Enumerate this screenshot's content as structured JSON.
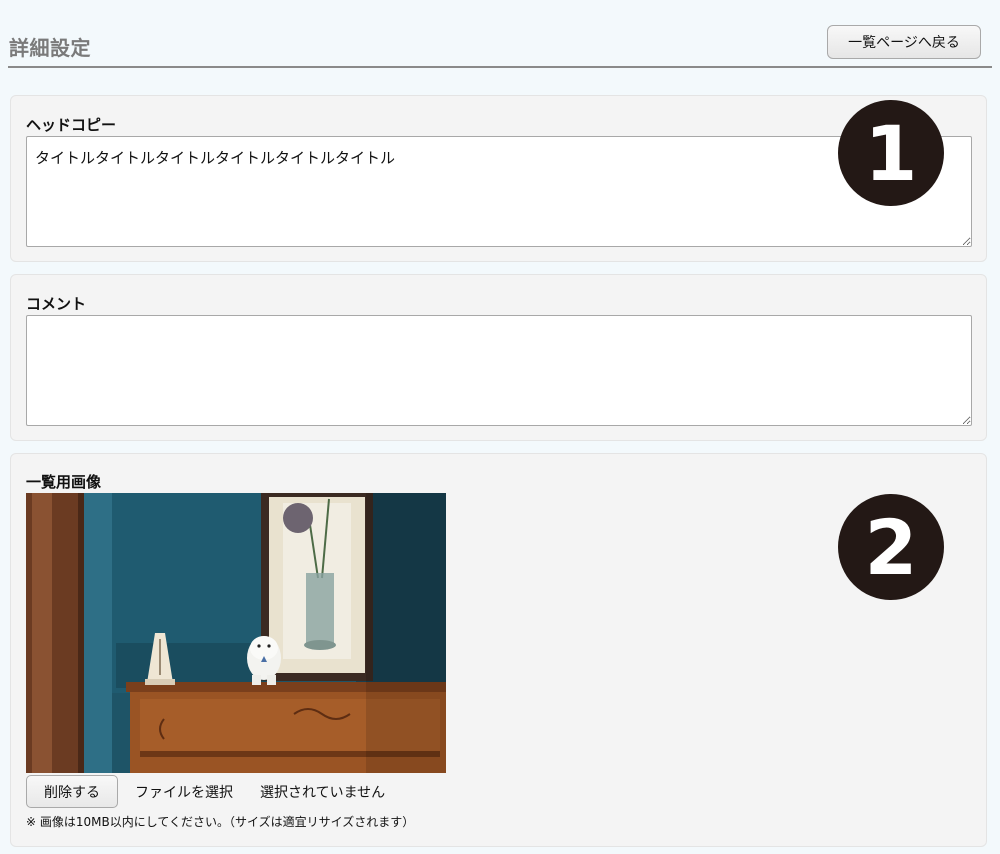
{
  "header": {
    "title": "詳細設定",
    "back_button": "一覧ページへ戻る"
  },
  "head_copy": {
    "label": "ヘッドコピー",
    "value": "タイトルタイトルタイトルタイトルタイトルタイトル",
    "badge": "1"
  },
  "comment": {
    "label": "コメント",
    "value": ""
  },
  "list_image": {
    "label": "一覧用画像",
    "badge": "2",
    "delete_button": "削除する",
    "file_select": "ファイルを選択",
    "file_status": "選択されていません",
    "note": "※ 画像は10MB以内にしてください。（サイズは適宜リサイズされます）"
  },
  "colors": {
    "background": "#f3f9fc",
    "panel": "#f4f4f4",
    "badge": "#231815",
    "title": "#7a7a7a"
  }
}
